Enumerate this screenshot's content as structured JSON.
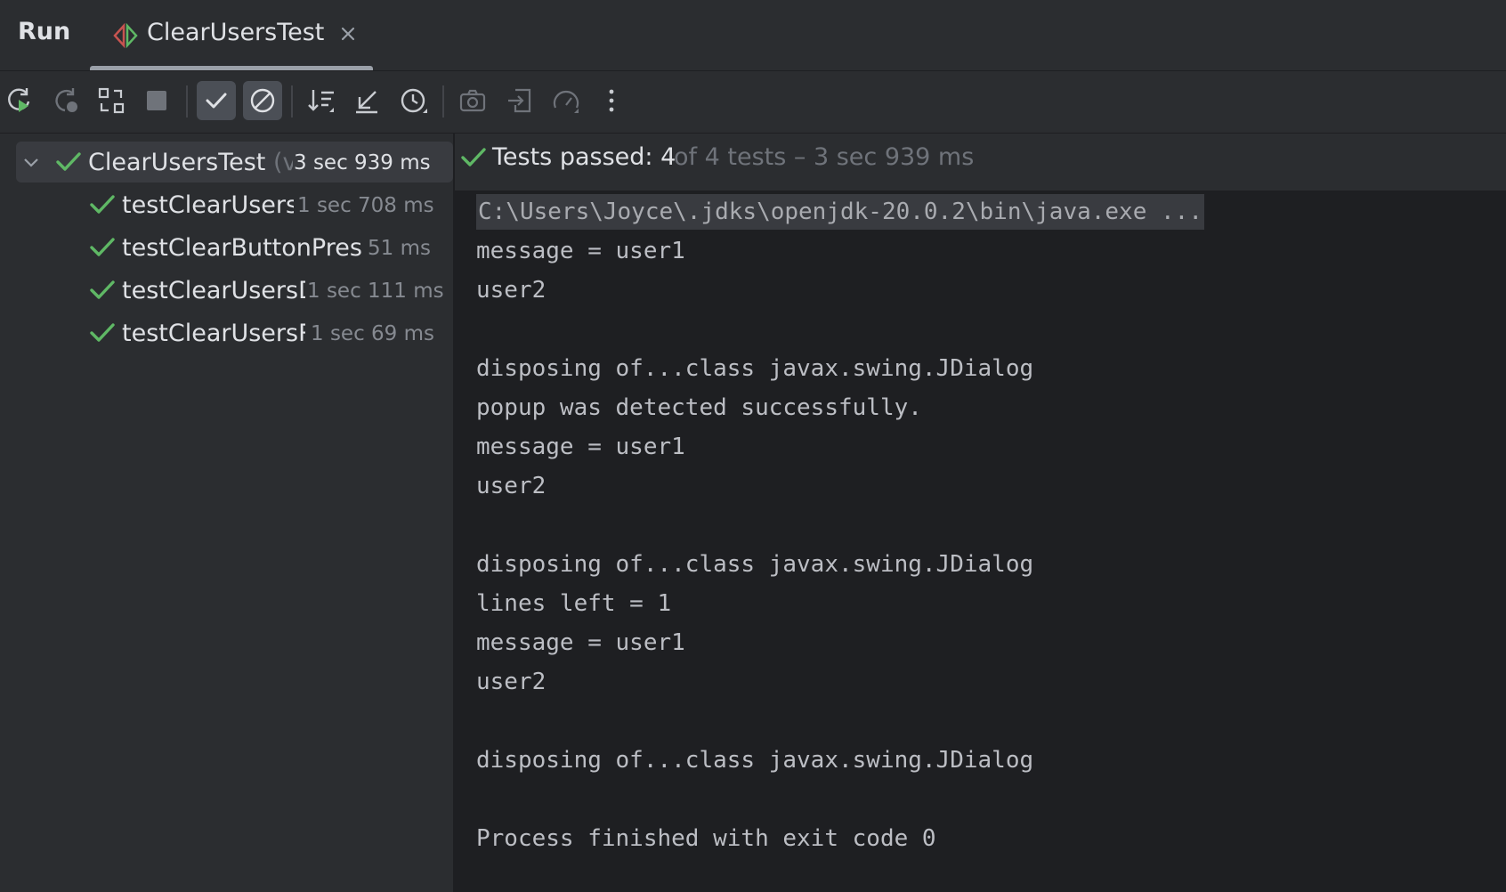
{
  "header": {
    "run_label": "Run",
    "tab_label": "ClearUsersTest"
  },
  "toolbar": {
    "buttons": [
      {
        "icon": "rerun-icon"
      },
      {
        "icon": "rerun-failed-icon"
      },
      {
        "icon": "toggle-auto-test-icon"
      },
      {
        "icon": "stop-icon"
      },
      {
        "icon": "show-passed-icon",
        "active": true
      },
      {
        "icon": "show-ignored-icon",
        "active": true
      },
      {
        "icon": "sort-alphabetically-icon"
      },
      {
        "icon": "collapse-all-icon"
      },
      {
        "icon": "sort-by-duration-icon"
      },
      {
        "icon": "camera-icon"
      },
      {
        "icon": "import-tests-icon"
      },
      {
        "icon": "coverage-icon"
      },
      {
        "icon": "more-options-icon"
      }
    ]
  },
  "tree": {
    "root": {
      "name": "ClearUsersTest",
      "name_suffix": "(v",
      "time": "3 sec 939 ms",
      "status": "passed"
    },
    "items": [
      {
        "name": "testClearUsersF",
        "time": "1 sec 708 ms",
        "status": "passed"
      },
      {
        "name": "testClearButtonPreser",
        "time": "51 ms",
        "status": "passed"
      },
      {
        "name": "testClearUsersD",
        "time": "1 sec 111 ms",
        "status": "passed"
      },
      {
        "name": "testClearUsersR",
        "time": "1 sec 69 ms",
        "status": "passed"
      }
    ]
  },
  "status": {
    "passed": "Tests passed: 4",
    "summary": "of 4 tests – 3 sec 939 ms"
  },
  "console": {
    "lines": [
      "C:\\Users\\Joyce\\.jdks\\openjdk-20.0.2\\bin\\java.exe ...",
      "message = user1",
      "user2",
      "",
      "disposing of...class javax.swing.JDialog",
      "popup was detected successfully.",
      "message = user1",
      "user2",
      "",
      "disposing of...class javax.swing.JDialog",
      "lines left = 1",
      "message = user1",
      "user2",
      "",
      "disposing of...class javax.swing.JDialog",
      "",
      "Process finished with exit code 0"
    ]
  },
  "colors": {
    "success": "#5fb865",
    "background": "#2b2d30",
    "console_background": "#1e1f22"
  }
}
